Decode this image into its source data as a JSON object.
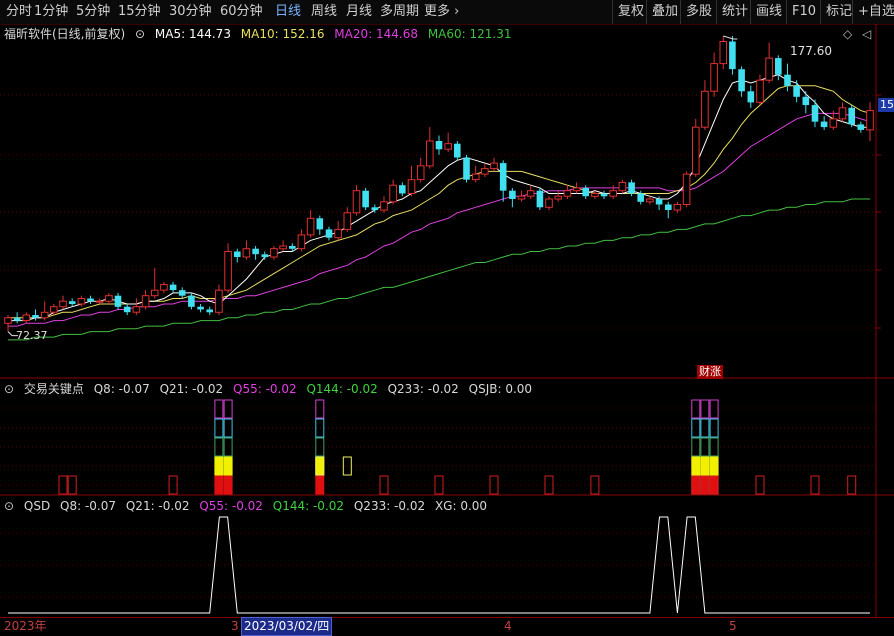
{
  "toolbar": {
    "periods": [
      "分时",
      "1分钟",
      "5分钟",
      "15分钟",
      "30分钟",
      "60分钟",
      "日线",
      "周线",
      "月线",
      "多周期",
      "更多"
    ],
    "active_period": "日线",
    "more_chevron": "›",
    "right_buttons": [
      "复权",
      "叠加",
      "多股",
      "统计",
      "画线",
      "F10",
      "标记",
      "+自选"
    ]
  },
  "main_panel": {
    "title": "福昕软件(日线,前复权)",
    "ma5": "MA5: 144.73",
    "ma10": "MA10: 152.16",
    "ma20": "MA20: 144.68",
    "ma60": "MA60: 121.31",
    "high_label": "177.60",
    "low_label": "72.37",
    "price_tag": "15",
    "event_tag": "财涨",
    "colors": {
      "ma5": "#ffffff",
      "ma10": "#e8e060",
      "ma20": "#e040e0",
      "ma60": "#40c040",
      "up": "#e03030",
      "down": "#40e0f0"
    }
  },
  "indicator1": {
    "name": "交易关键点",
    "q8": "Q8: -0.07",
    "q21": "Q21: -0.02",
    "q55": "Q55: -0.02",
    "q144": "Q144: -0.02",
    "q233": "Q233: -0.02",
    "qsjb": "QSJB: 0.00"
  },
  "indicator2": {
    "name": "QSD",
    "q8": "Q8: -0.07",
    "q21": "Q21: -0.02",
    "q55": "Q55: -0.02",
    "q144": "Q144: -0.02",
    "q233": "Q233: -0.02",
    "xg": "XG: 0.00"
  },
  "x_axis": {
    "year": "2023年",
    "m3": "3",
    "cursor_date": "2023/03/02/四",
    "m4": "4",
    "m5": "5"
  },
  "chart_data": {
    "type": "candlestick",
    "title": "福昕软件(日线,前复权)",
    "high": 177.6,
    "low": 72.37,
    "last_ma": {
      "MA5": 144.73,
      "MA10": 152.16,
      "MA20": 144.68,
      "MA60": 121.31
    },
    "candles": [
      {
        "o": 76,
        "c": 78,
        "h": 79,
        "l": 73
      },
      {
        "o": 78,
        "c": 77,
        "h": 80,
        "l": 76
      },
      {
        "o": 77,
        "c": 79,
        "h": 80,
        "l": 76
      },
      {
        "o": 79,
        "c": 78,
        "h": 81,
        "l": 77
      },
      {
        "o": 78,
        "c": 80,
        "h": 84,
        "l": 77
      },
      {
        "o": 80,
        "c": 82,
        "h": 83,
        "l": 79
      },
      {
        "o": 82,
        "c": 84,
        "h": 86,
        "l": 81
      },
      {
        "o": 84,
        "c": 83,
        "h": 85,
        "l": 82
      },
      {
        "o": 83,
        "c": 85,
        "h": 86,
        "l": 82
      },
      {
        "o": 85,
        "c": 84,
        "h": 86,
        "l": 83
      },
      {
        "o": 84,
        "c": 84,
        "h": 85,
        "l": 83
      },
      {
        "o": 84,
        "c": 86,
        "h": 87,
        "l": 83
      },
      {
        "o": 86,
        "c": 82,
        "h": 87,
        "l": 81
      },
      {
        "o": 82,
        "c": 80,
        "h": 83,
        "l": 79
      },
      {
        "o": 80,
        "c": 82,
        "h": 85,
        "l": 79
      },
      {
        "o": 82,
        "c": 86,
        "h": 88,
        "l": 81
      },
      {
        "o": 86,
        "c": 88,
        "h": 96,
        "l": 85
      },
      {
        "o": 88,
        "c": 90,
        "h": 91,
        "l": 87
      },
      {
        "o": 90,
        "c": 88,
        "h": 91,
        "l": 87
      },
      {
        "o": 88,
        "c": 86,
        "h": 89,
        "l": 85
      },
      {
        "o": 86,
        "c": 82,
        "h": 87,
        "l": 81
      },
      {
        "o": 82,
        "c": 81,
        "h": 83,
        "l": 80
      },
      {
        "o": 81,
        "c": 80,
        "h": 82,
        "l": 79
      },
      {
        "o": 80,
        "c": 88,
        "h": 90,
        "l": 79
      },
      {
        "o": 88,
        "c": 102,
        "h": 105,
        "l": 87
      },
      {
        "o": 102,
        "c": 100,
        "h": 103,
        "l": 98
      },
      {
        "o": 100,
        "c": 103,
        "h": 106,
        "l": 99
      },
      {
        "o": 103,
        "c": 101,
        "h": 104,
        "l": 99
      },
      {
        "o": 101,
        "c": 100,
        "h": 102,
        "l": 99
      },
      {
        "o": 100,
        "c": 103,
        "h": 104,
        "l": 99
      },
      {
        "o": 103,
        "c": 104,
        "h": 106,
        "l": 102
      },
      {
        "o": 104,
        "c": 103,
        "h": 105,
        "l": 102
      },
      {
        "o": 103,
        "c": 108,
        "h": 110,
        "l": 102
      },
      {
        "o": 108,
        "c": 114,
        "h": 117,
        "l": 107
      },
      {
        "o": 114,
        "c": 110,
        "h": 115,
        "l": 108
      },
      {
        "o": 110,
        "c": 107,
        "h": 111,
        "l": 106
      },
      {
        "o": 107,
        "c": 110,
        "h": 113,
        "l": 106
      },
      {
        "o": 110,
        "c": 116,
        "h": 118,
        "l": 109
      },
      {
        "o": 116,
        "c": 124,
        "h": 126,
        "l": 115
      },
      {
        "o": 124,
        "c": 118,
        "h": 125,
        "l": 117
      },
      {
        "o": 118,
        "c": 117,
        "h": 119,
        "l": 116
      },
      {
        "o": 117,
        "c": 120,
        "h": 122,
        "l": 116
      },
      {
        "o": 120,
        "c": 126,
        "h": 128,
        "l": 119
      },
      {
        "o": 126,
        "c": 123,
        "h": 127,
        "l": 122
      },
      {
        "o": 123,
        "c": 128,
        "h": 133,
        "l": 122
      },
      {
        "o": 128,
        "c": 133,
        "h": 136,
        "l": 127
      },
      {
        "o": 133,
        "c": 142,
        "h": 147,
        "l": 132
      },
      {
        "o": 142,
        "c": 139,
        "h": 144,
        "l": 137
      },
      {
        "o": 139,
        "c": 141,
        "h": 145,
        "l": 138
      },
      {
        "o": 141,
        "c": 136,
        "h": 142,
        "l": 135
      },
      {
        "o": 136,
        "c": 128,
        "h": 137,
        "l": 127
      },
      {
        "o": 128,
        "c": 130,
        "h": 133,
        "l": 127
      },
      {
        "o": 130,
        "c": 132,
        "h": 134,
        "l": 129
      },
      {
        "o": 132,
        "c": 134,
        "h": 136,
        "l": 131
      },
      {
        "o": 134,
        "c": 124,
        "h": 135,
        "l": 120
      },
      {
        "o": 124,
        "c": 121,
        "h": 125,
        "l": 118
      },
      {
        "o": 121,
        "c": 122,
        "h": 124,
        "l": 120
      },
      {
        "o": 122,
        "c": 124,
        "h": 126,
        "l": 121
      },
      {
        "o": 124,
        "c": 118,
        "h": 125,
        "l": 117
      },
      {
        "o": 118,
        "c": 121,
        "h": 122,
        "l": 117
      },
      {
        "o": 121,
        "c": 122,
        "h": 124,
        "l": 120
      },
      {
        "o": 122,
        "c": 124,
        "h": 126,
        "l": 121
      },
      {
        "o": 124,
        "c": 125,
        "h": 127,
        "l": 123
      },
      {
        "o": 125,
        "c": 122,
        "h": 126,
        "l": 121
      },
      {
        "o": 122,
        "c": 123,
        "h": 124,
        "l": 121
      },
      {
        "o": 123,
        "c": 122,
        "h": 124,
        "l": 121
      },
      {
        "o": 122,
        "c": 124,
        "h": 126,
        "l": 121
      },
      {
        "o": 124,
        "c": 127,
        "h": 128,
        "l": 123
      },
      {
        "o": 127,
        "c": 123,
        "h": 128,
        "l": 122
      },
      {
        "o": 123,
        "c": 120,
        "h": 124,
        "l": 119
      },
      {
        "o": 120,
        "c": 121,
        "h": 122,
        "l": 119
      },
      {
        "o": 121,
        "c": 119,
        "h": 122,
        "l": 117
      },
      {
        "o": 119,
        "c": 117,
        "h": 120,
        "l": 114
      },
      {
        "o": 117,
        "c": 119,
        "h": 120,
        "l": 116
      },
      {
        "o": 119,
        "c": 130,
        "h": 131,
        "l": 118
      },
      {
        "o": 130,
        "c": 147,
        "h": 150,
        "l": 129
      },
      {
        "o": 147,
        "c": 160,
        "h": 164,
        "l": 146
      },
      {
        "o": 160,
        "c": 170,
        "h": 174,
        "l": 158
      },
      {
        "o": 170,
        "c": 178,
        "h": 180,
        "l": 168
      },
      {
        "o": 178,
        "c": 168,
        "h": 180,
        "l": 166
      },
      {
        "o": 168,
        "c": 160,
        "h": 169,
        "l": 158
      },
      {
        "o": 160,
        "c": 156,
        "h": 162,
        "l": 154
      },
      {
        "o": 156,
        "c": 164,
        "h": 166,
        "l": 155
      },
      {
        "o": 164,
        "c": 172,
        "h": 177.6,
        "l": 163
      },
      {
        "o": 172,
        "c": 166,
        "h": 173,
        "l": 164
      },
      {
        "o": 166,
        "c": 162,
        "h": 170,
        "l": 160
      },
      {
        "o": 162,
        "c": 158,
        "h": 164,
        "l": 156
      },
      {
        "o": 158,
        "c": 155,
        "h": 160,
        "l": 152
      },
      {
        "o": 155,
        "c": 149,
        "h": 157,
        "l": 147
      },
      {
        "o": 149,
        "c": 147,
        "h": 151,
        "l": 146
      },
      {
        "o": 147,
        "c": 150,
        "h": 153,
        "l": 146
      },
      {
        "o": 150,
        "c": 154,
        "h": 156,
        "l": 149
      },
      {
        "o": 154,
        "c": 148,
        "h": 155,
        "l": 147
      },
      {
        "o": 148,
        "c": 146,
        "h": 149,
        "l": 145
      },
      {
        "o": 146,
        "c": 153,
        "h": 156,
        "l": 142
      }
    ],
    "ma5": [
      77,
      77,
      77,
      78,
      78,
      80,
      81,
      82,
      83,
      84,
      84,
      85,
      84,
      83,
      83,
      84,
      84,
      85,
      87,
      87,
      87,
      86,
      84,
      83,
      86,
      89,
      92,
      96,
      100,
      101,
      102,
      102,
      104,
      106,
      107,
      108,
      109,
      111,
      113,
      115,
      117,
      119,
      120,
      121,
      123,
      124,
      127,
      130,
      133,
      135,
      136,
      135,
      134,
      133,
      130,
      128,
      127,
      126,
      125,
      123,
      123,
      123,
      123,
      123,
      124,
      123,
      123,
      123,
      124,
      123,
      122,
      121,
      121,
      123,
      127,
      133,
      141,
      149,
      157,
      163,
      164,
      163,
      164,
      165,
      166,
      164,
      163,
      159,
      156,
      152,
      150,
      149,
      148,
      147,
      147
    ],
    "ma10": [
      78,
      78,
      78,
      78,
      78,
      79,
      80,
      80,
      81,
      82,
      83,
      83,
      83,
      83,
      83,
      84,
      84,
      84,
      85,
      85,
      86,
      85,
      85,
      85,
      86,
      87,
      88,
      90,
      92,
      94,
      96,
      98,
      100,
      102,
      104,
      105,
      106,
      107,
      108,
      110,
      112,
      113,
      115,
      116,
      117,
      119,
      121,
      123,
      126,
      128,
      129,
      130,
      131,
      131,
      131,
      131,
      131,
      130,
      129,
      128,
      127,
      126,
      125,
      124,
      123,
      123,
      123,
      123,
      123,
      123,
      123,
      123,
      123,
      124,
      125,
      127,
      130,
      134,
      139,
      143,
      148,
      152,
      155,
      158,
      161,
      162,
      162,
      162,
      162,
      161,
      160,
      157,
      155,
      153,
      152
    ],
    "ma20": [
      75,
      75,
      76,
      76,
      76,
      77,
      77,
      78,
      79,
      79,
      80,
      80,
      81,
      81,
      82,
      82,
      82,
      83,
      83,
      84,
      84,
      84,
      84,
      85,
      85,
      85,
      86,
      86,
      87,
      88,
      89,
      90,
      91,
      92,
      94,
      95,
      96,
      97,
      99,
      100,
      102,
      104,
      105,
      107,
      109,
      110,
      112,
      113,
      114,
      116,
      117,
      118,
      119,
      120,
      121,
      122,
      122,
      123,
      123,
      124,
      124,
      124,
      125,
      125,
      125,
      125,
      125,
      125,
      125,
      125,
      125,
      125,
      124,
      124,
      124,
      125,
      127,
      129,
      131,
      134,
      137,
      140,
      142,
      144,
      146,
      148,
      150,
      151,
      152,
      152,
      152,
      152,
      151,
      150,
      149
    ],
    "ma60": [
      70,
      70,
      70,
      71,
      71,
      71,
      72,
      72,
      72,
      73,
      73,
      73,
      74,
      74,
      74,
      75,
      75,
      75,
      76,
      76,
      76,
      77,
      77,
      77,
      78,
      78,
      79,
      79,
      80,
      80,
      81,
      81,
      82,
      83,
      83,
      84,
      85,
      85,
      86,
      87,
      88,
      89,
      89,
      90,
      91,
      92,
      93,
      94,
      95,
      96,
      97,
      98,
      98,
      99,
      100,
      101,
      101,
      102,
      102,
      103,
      103,
      104,
      104,
      105,
      105,
      106,
      106,
      107,
      107,
      108,
      108,
      109,
      109,
      110,
      110,
      111,
      112,
      112,
      113,
      114,
      115,
      115,
      116,
      117,
      117,
      118,
      118,
      119,
      119,
      120,
      120,
      120,
      121,
      121,
      121
    ],
    "signals": [
      0,
      0,
      0,
      0,
      0,
      0,
      0,
      0,
      0,
      0,
      0,
      0,
      0,
      0,
      0,
      0,
      0,
      0,
      0,
      0,
      0,
      0,
      0,
      1,
      1,
      0,
      0,
      0,
      0,
      0,
      0,
      0,
      0,
      0,
      1,
      0,
      0,
      0,
      0,
      0,
      0,
      0,
      0,
      0,
      0,
      0,
      0,
      0,
      0,
      0,
      0,
      0,
      0,
      0,
      0,
      0,
      0,
      0,
      0,
      0,
      0,
      0,
      0,
      0,
      0,
      0,
      0,
      0,
      0,
      0,
      0,
      0,
      0,
      0,
      0,
      1,
      1,
      1,
      0,
      0,
      0,
      0,
      0,
      0,
      0,
      0,
      0,
      0,
      0,
      0,
      0,
      0,
      0,
      0,
      0
    ],
    "qsd_peaks": [
      {
        "start": 22,
        "end": 25
      },
      {
        "start": 70,
        "end": 73
      },
      {
        "start": 73,
        "end": 76
      }
    ]
  }
}
